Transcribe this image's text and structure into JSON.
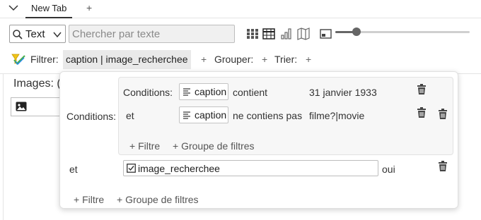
{
  "tab_bar": {
    "active_tab": "New Tab",
    "add_symbol": "+"
  },
  "toolbar": {
    "type_select": "Text",
    "search_placeholder": "Chercher par texte",
    "zoom_slider_value": 0.16
  },
  "filter_bar": {
    "filter_label": "Filtrer:",
    "filter_chip": "caption | image_recherchee",
    "group_label": "Grouper:",
    "sort_label": "Trier:",
    "add_symbol": "+"
  },
  "left_panel": {
    "images_label": "Images:",
    "images_count_partial": "("
  },
  "filter_popover": {
    "conditions_label": "Conditions:",
    "inner_group": {
      "conditions_label": "Conditions:",
      "rows": [
        {
          "prefix": "Conditions:",
          "field": "caption",
          "operator": "contient",
          "value": "31 janvier 1933"
        },
        {
          "prefix": "et",
          "field": "caption",
          "operator": "ne contiens pas",
          "value": "filme?|movie"
        }
      ],
      "add_filter": "+ Filtre",
      "add_group": "+ Groupe de filtres"
    },
    "outer_row": {
      "prefix": "et",
      "field": "image_recherchee",
      "value": "oui"
    },
    "add_filter": "+ Filtre",
    "add_group": "+ Groupe de filtres"
  }
}
